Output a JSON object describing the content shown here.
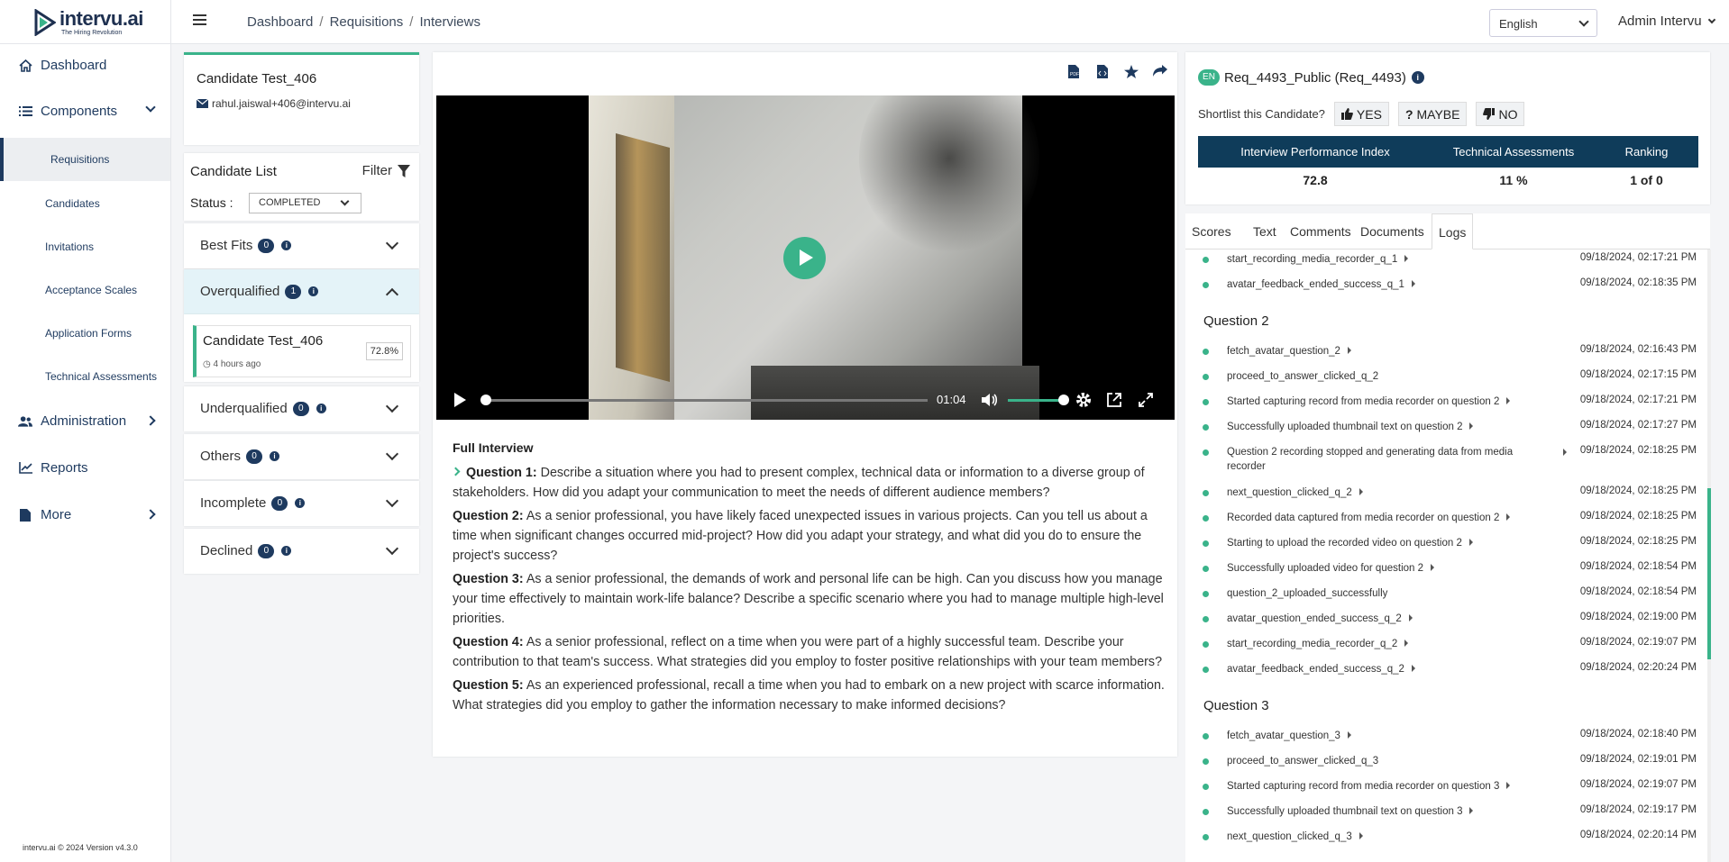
{
  "header": {
    "logo_name": "intervu.ai",
    "logo_tagline": "The Hiring Revolution",
    "breadcrumb": [
      "Dashboard",
      "Requisitions",
      "Interviews"
    ],
    "language": "English",
    "user": "Admin Intervu"
  },
  "sidebar": {
    "items": [
      {
        "label": "Dashboard",
        "icon": "home-icon"
      },
      {
        "label": "Components",
        "icon": "list-icon"
      },
      {
        "label": "Administration",
        "icon": "users-icon"
      },
      {
        "label": "Reports",
        "icon": "chart-icon"
      },
      {
        "label": "More",
        "icon": "file-icon"
      }
    ],
    "sub_items": [
      "Requisitions",
      "Candidates",
      "Invitations",
      "Acceptance Scales",
      "Application Forms",
      "Technical Assessments"
    ],
    "footer": "intervu.ai © 2024 Version v4.3.0"
  },
  "candidate": {
    "name": "Candidate Test_406",
    "email": "rahul.jaiswal+406@intervu.ai"
  },
  "candidate_list": {
    "title": "Candidate List",
    "filter_label": "Filter",
    "status_label": "Status :",
    "status_value": "COMPLETED",
    "groups": [
      {
        "label": "Best Fits",
        "count": "0"
      },
      {
        "label": "Overqualified",
        "count": "1"
      },
      {
        "label": "Underqualified",
        "count": "0"
      },
      {
        "label": "Others",
        "count": "0"
      },
      {
        "label": "Incomplete",
        "count": "0"
      },
      {
        "label": "Declined",
        "count": "0"
      }
    ],
    "expanded_item": {
      "name": "Candidate Test_406",
      "time": "4 hours ago",
      "score": "72.8%"
    }
  },
  "video": {
    "time": "01:04",
    "progress": 0.0,
    "volume": 1.0
  },
  "interview": {
    "title": "Full Interview",
    "questions": [
      {
        "label": "Question 1:",
        "text": " Describe a situation where you had to present complex, technical data or information to a diverse group of stakeholders. How did you adapt your communication to meet the needs of different audience members?"
      },
      {
        "label": "Question 2:",
        "text": " As a senior professional, you have likely faced unexpected issues in various projects. Can you tell us about a time when significant changes occurred mid-project? How did you adapt your strategy, and what did you do to ensure the project's success?"
      },
      {
        "label": "Question 3:",
        "text": " As a senior professional, the demands of work and personal life can be high. Can you discuss how you manage your time effectively to maintain work-life balance? Describe a specific scenario where you had to manage multiple high-level priorities."
      },
      {
        "label": "Question 4:",
        "text": " As a senior professional, reflect on a time when you were part of a highly successful team. Describe your contribution to that team's success. What strategies did you employ to foster positive relationships with your team members?"
      },
      {
        "label": "Question 5:",
        "text": " As an experienced professional, recall a time when you had to embark on a new project with scarce information. What strategies did you employ to gather the information necessary to make informed decisions?"
      }
    ]
  },
  "requisition": {
    "lang_badge": "EN",
    "title": "Req_4493_Public (Req_4493)",
    "shortlist_label": "Shortlist this Candidate?",
    "yes": "YES",
    "maybe": "MAYBE",
    "no": "NO",
    "metrics_headers": [
      "Interview Performance Index",
      "Technical Assessments",
      "Ranking"
    ],
    "metrics_values": [
      "72.8",
      "11 %",
      "1 of 0"
    ]
  },
  "tabs": [
    "Scores",
    "Text",
    "Comments",
    "Documents",
    "Logs"
  ],
  "logs": {
    "q1_tail": [
      {
        "event": "start_recording_media_recorder_q_1",
        "time": "09/18/2024, 02:17:21 PM",
        "arrow": true
      },
      {
        "event": "avatar_feedback_ended_success_q_1",
        "time": "09/18/2024, 02:18:35 PM",
        "arrow": true
      }
    ],
    "q2_title": "Question 2",
    "q2": [
      {
        "event": "fetch_avatar_question_2",
        "time": "09/18/2024, 02:16:43 PM",
        "arrow": true
      },
      {
        "event": "proceed_to_answer_clicked_q_2",
        "time": "09/18/2024, 02:17:15 PM",
        "arrow": false
      },
      {
        "event": "Started capturing record from media recorder on question 2",
        "time": "09/18/2024, 02:17:21 PM",
        "arrow": true
      },
      {
        "event": "Successfully uploaded thumbnail text on question 2",
        "time": "09/18/2024, 02:17:27 PM",
        "arrow": true
      },
      {
        "event": "Question 2 recording stopped and generating data from media recorder",
        "time": "09/18/2024, 02:18:25 PM",
        "arrow": true
      },
      {
        "event": "next_question_clicked_q_2",
        "time": "09/18/2024, 02:18:25 PM",
        "arrow": true
      },
      {
        "event": "Recorded data captured from media recorder on question 2",
        "time": "09/18/2024, 02:18:25 PM",
        "arrow": true
      },
      {
        "event": "Starting to upload the recorded video on question 2",
        "time": "09/18/2024, 02:18:25 PM",
        "arrow": true
      },
      {
        "event": "Successfully uploaded video for question 2",
        "time": "09/18/2024, 02:18:54 PM",
        "arrow": true
      },
      {
        "event": "question_2_uploaded_successfully",
        "time": "09/18/2024, 02:18:54 PM",
        "arrow": false
      },
      {
        "event": "avatar_question_ended_success_q_2",
        "time": "09/18/2024, 02:19:00 PM",
        "arrow": true
      },
      {
        "event": "start_recording_media_recorder_q_2",
        "time": "09/18/2024, 02:19:07 PM",
        "arrow": true
      },
      {
        "event": "avatar_feedback_ended_success_q_2",
        "time": "09/18/2024, 02:20:24 PM",
        "arrow": true
      }
    ],
    "q3_title": "Question 3",
    "q3": [
      {
        "event": "fetch_avatar_question_3",
        "time": "09/18/2024, 02:18:40 PM",
        "arrow": true
      },
      {
        "event": "proceed_to_answer_clicked_q_3",
        "time": "09/18/2024, 02:19:01 PM",
        "arrow": false
      },
      {
        "event": "Started capturing record from media recorder on question 3",
        "time": "09/18/2024, 02:19:07 PM",
        "arrow": true
      },
      {
        "event": "Successfully uploaded thumbnail text on question 3",
        "time": "09/18/2024, 02:19:17 PM",
        "arrow": true
      },
      {
        "event": "next_question_clicked_q_3",
        "time": "09/18/2024, 02:20:14 PM",
        "arrow": true
      }
    ]
  },
  "colors": {
    "accent": "#3ab38a",
    "navy": "#1e3a5f",
    "metrics_header": "#0f3c5a"
  }
}
